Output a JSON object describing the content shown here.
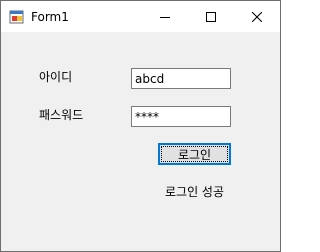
{
  "window": {
    "title": "Form1",
    "icons": {
      "app": "form-app-icon",
      "minimize": "minimize-icon",
      "maximize": "maximize-icon",
      "close": "close-icon"
    }
  },
  "form": {
    "id_label": "아이디",
    "id_value": "abcd",
    "password_label": "패스워드",
    "password_value": "****",
    "login_button": "로그인",
    "status": "로그인 성공"
  },
  "colors": {
    "titlebar": "#ffffff",
    "client_bg": "#f0f0f0",
    "button_bg": "#e1e1e1",
    "focus_accent": "#0078d7"
  }
}
